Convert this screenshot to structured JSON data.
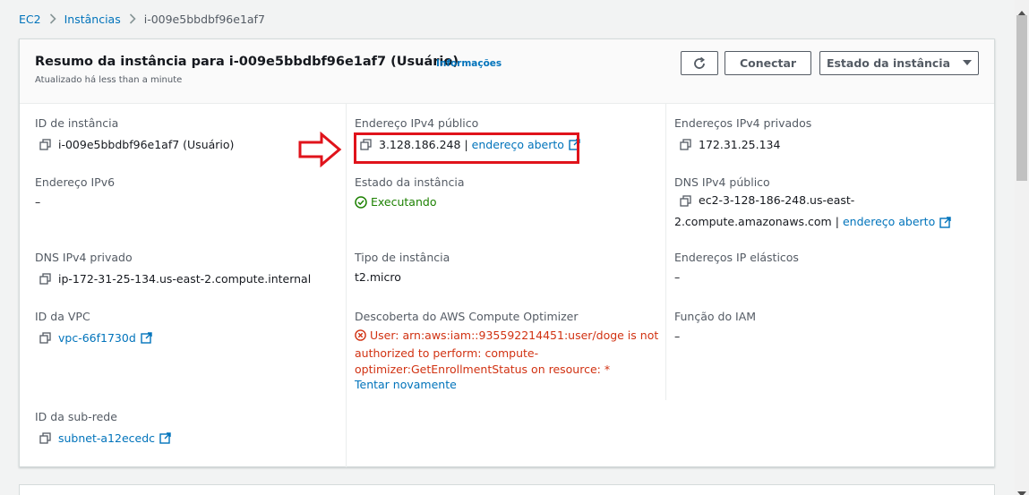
{
  "breadcrumb": {
    "items": [
      "EC2",
      "Instâncias"
    ],
    "current": "i-009e5bbdbf96e1af7"
  },
  "header": {
    "title": "Resumo da instância para i-009e5bbdbf96e1af7 (Usuário)",
    "info_link": "Informações",
    "updated": "Atualizado há less than a minute",
    "connect_label": "Conectar",
    "state_label": "Estado da instância"
  },
  "fields": {
    "instance_id": {
      "label": "ID de instância",
      "value": "i-009e5bbdbf96e1af7 (Usuário)"
    },
    "public_ipv4": {
      "label": "Endereço IPv4 público",
      "value": "3.128.186.248",
      "link": "endereço aberto"
    },
    "private_ipv4": {
      "label": "Endereços IPv4 privados",
      "value": "172.31.25.134"
    },
    "ipv6": {
      "label": "Endereço IPv6",
      "value": "–"
    },
    "state": {
      "label": "Estado da instância",
      "value": "Executando"
    },
    "public_dns": {
      "label": "DNS IPv4 público",
      "line1": "ec2-3-128-186-248.us-east-",
      "line2": "2.compute.amazonaws.com",
      "link": "endereço aberto"
    },
    "private_dns": {
      "label": "DNS IPv4 privado",
      "value": "ip-172-31-25-134.us-east-2.compute.internal"
    },
    "instance_type": {
      "label": "Tipo de instância",
      "value": "t2.micro"
    },
    "elastic_ip": {
      "label": "Endereços IP elásticos",
      "value": "–"
    },
    "vpc": {
      "label": "ID da VPC",
      "value": "vpc-66f1730d"
    },
    "optimizer": {
      "label": "Descoberta do AWS Compute Optimizer",
      "error_line1": "User: arn:aws:iam::935592214451:user/doge is not",
      "error_line2": "authorized to perform: compute-",
      "error_line3": "optimizer:GetEnrollmentStatus on resource: *",
      "retry": "Tentar novamente"
    },
    "iam_role": {
      "label": "Função do IAM",
      "value": "–"
    },
    "subnet": {
      "label": "ID da sub-rede",
      "value": "subnet-a12ecedc"
    }
  },
  "colors": {
    "link": "#0073bb",
    "success": "#1d8102",
    "error": "#d13212",
    "annotation": "#e0131b"
  },
  "icons": [
    "chevron-right-icon",
    "refresh-icon",
    "caret-down-icon",
    "copy-icon",
    "external-link-icon",
    "check-circle-icon",
    "error-x-icon",
    "annotation-arrow-icon"
  ]
}
